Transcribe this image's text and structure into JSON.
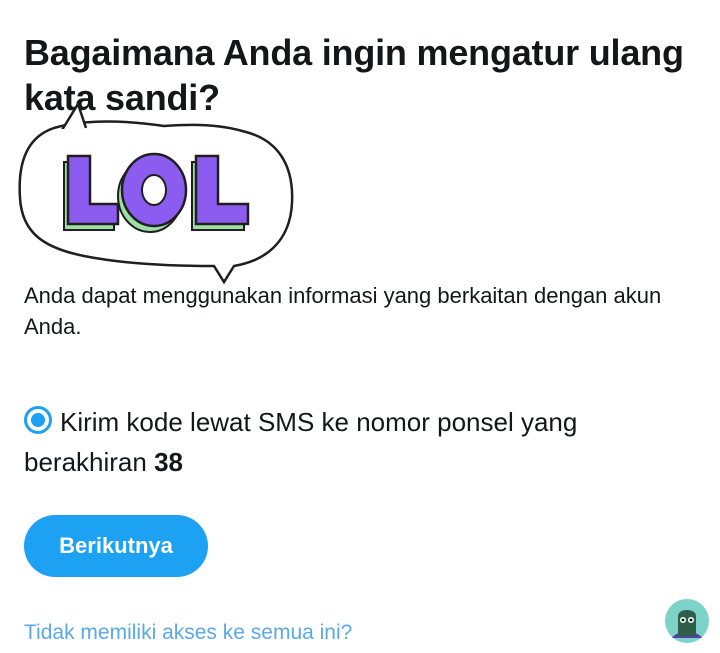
{
  "heading": "Bagaimana Anda ingin mengatur ulang kata sandi?",
  "sticker": {
    "text": "LOL",
    "icon": "lol-speech-bubble-sticker"
  },
  "description": "Anda dapat menggunakan informasi yang berkaitan dengan akun Anda.",
  "option": {
    "text": "Kirim kode lewat SMS ke nomor ponsel yang berakhiran",
    "digits": "38",
    "selected": true
  },
  "next_button": {
    "label": "Berikutnya"
  },
  "no_access_link": {
    "text": "Tidak memiliki akses ke semua ini?"
  },
  "avatar": {
    "icon": "avatar-icon"
  },
  "colors": {
    "accent": "#1da1f2",
    "text": "#14171a",
    "link": "#5aa9e6",
    "sticker_letters": "#8c5cf0",
    "sticker_shadow": "#9ce0a6"
  }
}
